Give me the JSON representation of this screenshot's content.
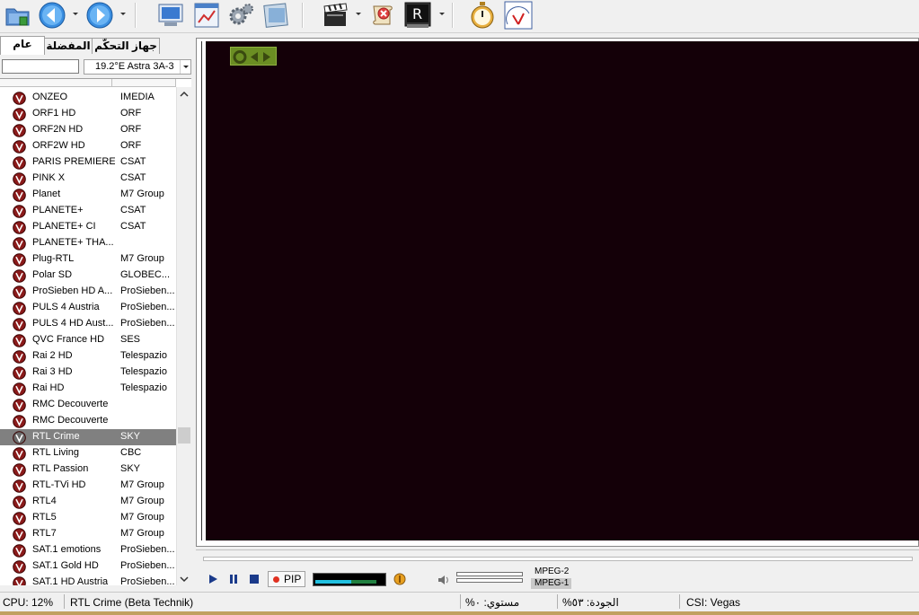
{
  "left_panel": {
    "tabs": [
      {
        "label": "عام",
        "active": true
      },
      {
        "label": "المفضلة",
        "active": false
      },
      {
        "label": "جهاز التحكّم",
        "active": false
      }
    ],
    "search": {
      "value": "",
      "placeholder": ""
    },
    "satellite": {
      "selected": "19.2°E Astra 3A-3"
    },
    "channels": [
      {
        "name": "ONZEO",
        "provider": "IMEDIA"
      },
      {
        "name": "ORF1 HD",
        "provider": "ORF"
      },
      {
        "name": "ORF2N HD",
        "provider": "ORF"
      },
      {
        "name": "ORF2W HD",
        "provider": "ORF"
      },
      {
        "name": "PARIS PREMIERE",
        "provider": "CSAT"
      },
      {
        "name": "PINK X",
        "provider": "CSAT"
      },
      {
        "name": "Planet",
        "provider": "M7 Group"
      },
      {
        "name": "PLANETE+",
        "provider": "CSAT"
      },
      {
        "name": "PLANETE+ CI",
        "provider": "CSAT"
      },
      {
        "name": "PLANETE+ THA...",
        "provider": ""
      },
      {
        "name": "Plug-RTL",
        "provider": "M7 Group"
      },
      {
        "name": "Polar SD",
        "provider": "GLOBEC..."
      },
      {
        "name": "ProSieben HD A...",
        "provider": "ProSieben..."
      },
      {
        "name": "PULS 4 Austria",
        "provider": "ProSieben..."
      },
      {
        "name": "PULS 4 HD Aust...",
        "provider": "ProSieben..."
      },
      {
        "name": "QVC France HD",
        "provider": "SES"
      },
      {
        "name": "Rai 2 HD",
        "provider": "Telespazio"
      },
      {
        "name": "Rai 3 HD",
        "provider": "Telespazio"
      },
      {
        "name": "Rai HD",
        "provider": "Telespazio"
      },
      {
        "name": "RMC Decouverte",
        "provider": ""
      },
      {
        "name": "RMC Decouverte",
        "provider": ""
      },
      {
        "name": "RTL Crime",
        "provider": "SKY",
        "selected": true
      },
      {
        "name": "RTL Living",
        "provider": "CBC"
      },
      {
        "name": "RTL Passion",
        "provider": "SKY"
      },
      {
        "name": "RTL-TVi HD",
        "provider": "M7 Group"
      },
      {
        "name": "RTL4",
        "provider": "M7 Group"
      },
      {
        "name": "RTL5",
        "provider": "M7 Group"
      },
      {
        "name": "RTL7",
        "provider": "M7 Group"
      },
      {
        "name": "SAT.1 emotions",
        "provider": "ProSieben..."
      },
      {
        "name": "SAT.1 Gold HD",
        "provider": "ProSieben..."
      },
      {
        "name": "SAT.1 HD Austria",
        "provider": "ProSieben..."
      }
    ]
  },
  "controls": {
    "pip_label": "PIP",
    "codec_top": "MPEG-2",
    "codec_bottom": "MPEG-1"
  },
  "status": {
    "cpu": "CPU: 12%",
    "channel": "RTL Crime (Beta Technik)",
    "level": "%مستوي: ٠",
    "quality": "%الجودة: ٥٣",
    "csi": "CSI: Vegas"
  },
  "icons": {
    "toolbar": [
      "open-folder-icon",
      "back-icon",
      "forward-icon",
      "monitor-icon",
      "epg-window-icon",
      "settings-gears-icon",
      "screenshot-icon",
      "clapper-icon",
      "scroll-icon",
      "record-icon",
      "stopwatch-icon",
      "signal-meter-icon"
    ]
  },
  "colors": {
    "video_bg": "#140008",
    "selected_row": "#808080",
    "osd_bg": "#6b8e23"
  }
}
